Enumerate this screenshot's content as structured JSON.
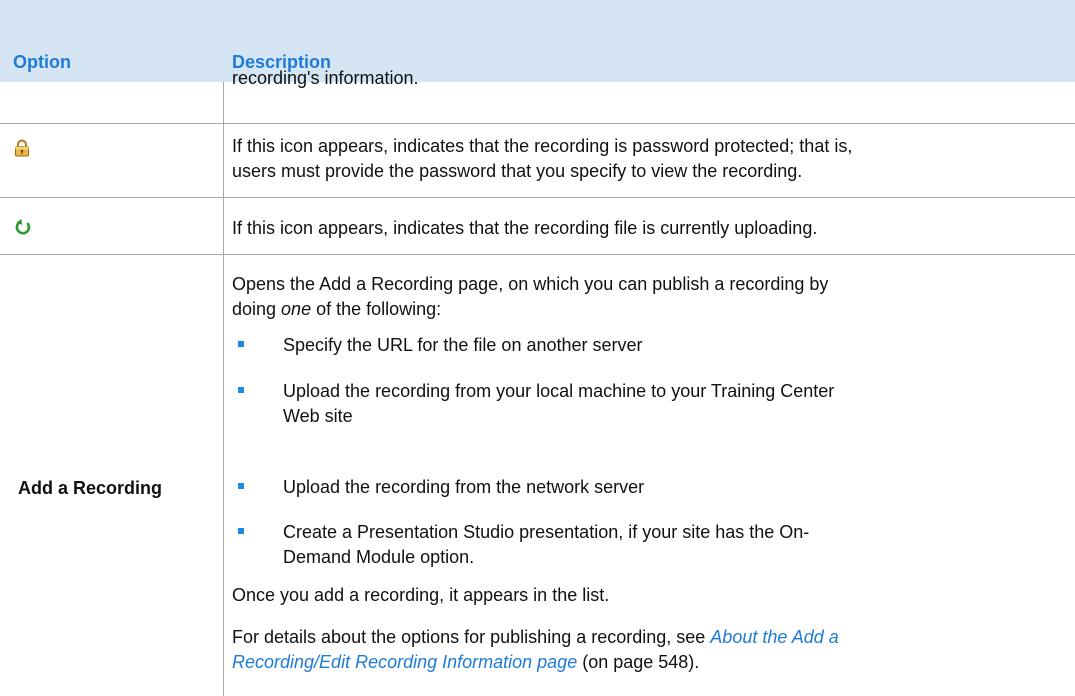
{
  "header": {
    "option": "Option",
    "description": "Description"
  },
  "rows": {
    "continued": {
      "text": "recording's information."
    },
    "password": {
      "icon": "lock-icon",
      "line1": "If this icon appears, indicates that the recording is password protected; that is,",
      "line2": "users must provide the password that you specify to view the recording."
    },
    "upload": {
      "icon": "upload-arrow-icon",
      "text": "If this icon appears, indicates that the recording file is currently uploading."
    },
    "add": {
      "option": "Add a Recording",
      "intro_line1": "Opens the Add a Recording page, on which you can publish a recording by",
      "intro_pre": "doing ",
      "intro_em": "one",
      "intro_post": " of the following:",
      "bullets": [
        {
          "line1": "Specify the URL for the file on another server",
          "line2": ""
        },
        {
          "line1": "Upload the recording from your local machine to your Training Center",
          "line2": "Web site"
        },
        {
          "line1": "Upload the recording from the network server",
          "line2": ""
        },
        {
          "line1": "Create a Presentation Studio presentation, if your site has the On-",
          "line2": "Demand Module option."
        }
      ],
      "once": "Once you add a recording, it appears in the list.",
      "details_pre": "For details about the options for publishing a recording, see ",
      "details_link1": "About the Add a",
      "details_link2": "Recording/Edit Recording Information page",
      "details_post": " (on page 548)."
    }
  },
  "colors": {
    "header_bg": "#d6e5f4",
    "header_text": "#1e7bd7",
    "bullet": "#1e88e5",
    "rule": "#a8a8a8"
  }
}
